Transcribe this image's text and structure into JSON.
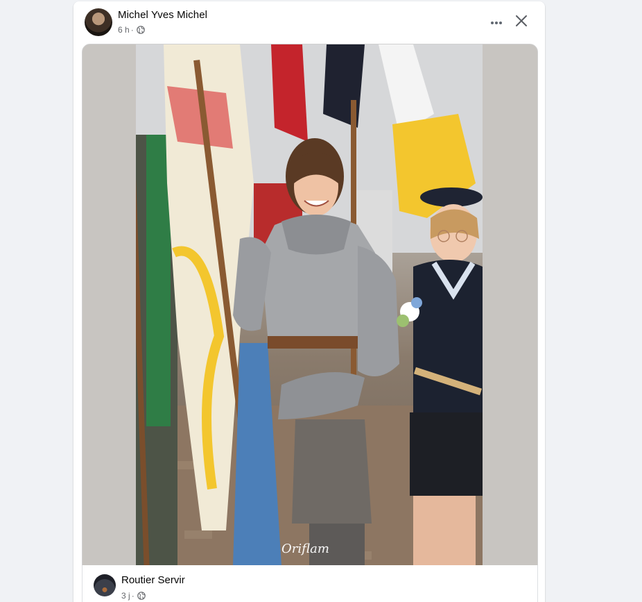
{
  "post": {
    "author": "Michel Yves Michel",
    "time": "6 h",
    "separator": "·",
    "privacy_icon": "globe-icon",
    "more_icon": "more-options-icon",
    "close_icon": "close-icon",
    "photo_watermark": "Oriflam"
  },
  "shared": {
    "author": "Routier Servir",
    "time": "3 j",
    "separator": "·",
    "privacy_icon": "globe-icon"
  },
  "colors": {
    "page_background": "#f0f2f5",
    "card_background": "#ffffff",
    "primary_text": "#050505",
    "secondary_text": "#65676b"
  }
}
